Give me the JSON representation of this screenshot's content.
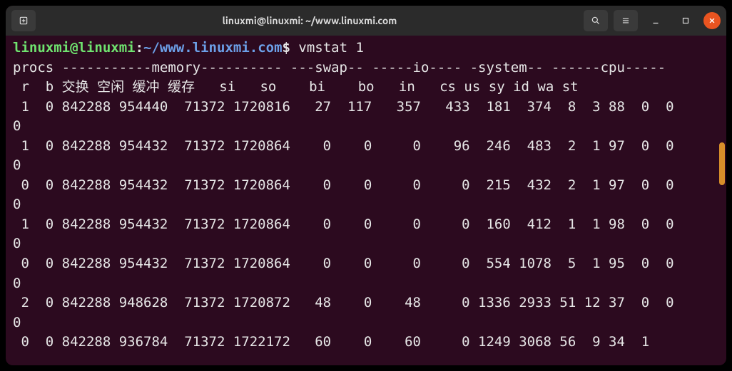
{
  "titlebar": {
    "title": "linuxmi@linuxmi: ~/www.linuxmi.com"
  },
  "prompt": {
    "user_host": "linuxmi@linuxmi",
    "colon": ":",
    "path": "~/www.linuxmi.com",
    "dollar": "$",
    "command": "vmstat 1"
  },
  "vmstat": {
    "header1": "procs -----------memory---------- ---swap-- -----io---- -system-- ------cpu-----",
    "header2": " r  b 交换 空闲 缓冲 缓存   si   so    bi    bo   in   cs us sy id wa st",
    "rows": [
      {
        "r": 1,
        "b": 0,
        "swpd": 842288,
        "free": 954440,
        "buff": 71372,
        "cache": 1720816,
        "si": 27,
        "so": 117,
        "bi": 357,
        "bo": 433,
        "in": 181,
        "cs": 374,
        "us": 8,
        "sy": 3,
        "id": 88,
        "wa": 0,
        "st": 0
      },
      {
        "r": 1,
        "b": 0,
        "swpd": 842288,
        "free": 954432,
        "buff": 71372,
        "cache": 1720864,
        "si": 0,
        "so": 0,
        "bi": 0,
        "bo": 96,
        "in": 246,
        "cs": 483,
        "us": 2,
        "sy": 1,
        "id": 97,
        "wa": 0,
        "st": 0
      },
      {
        "r": 0,
        "b": 0,
        "swpd": 842288,
        "free": 954432,
        "buff": 71372,
        "cache": 1720864,
        "si": 0,
        "so": 0,
        "bi": 0,
        "bo": 0,
        "in": 215,
        "cs": 432,
        "us": 2,
        "sy": 1,
        "id": 97,
        "wa": 0,
        "st": 0
      },
      {
        "r": 1,
        "b": 0,
        "swpd": 842288,
        "free": 954432,
        "buff": 71372,
        "cache": 1720864,
        "si": 0,
        "so": 0,
        "bi": 0,
        "bo": 0,
        "in": 160,
        "cs": 412,
        "us": 1,
        "sy": 1,
        "id": 98,
        "wa": 0,
        "st": 0
      },
      {
        "r": 0,
        "b": 0,
        "swpd": 842288,
        "free": 954432,
        "buff": 71372,
        "cache": 1720864,
        "si": 0,
        "so": 0,
        "bi": 0,
        "bo": 0,
        "in": 554,
        "cs": 1078,
        "us": 5,
        "sy": 1,
        "id": 95,
        "wa": 0,
        "st": 0
      },
      {
        "r": 2,
        "b": 0,
        "swpd": 842288,
        "free": 948628,
        "buff": 71372,
        "cache": 1720872,
        "si": 48,
        "so": 0,
        "bi": 48,
        "bo": 0,
        "in": 1336,
        "cs": 2933,
        "us": 51,
        "sy": 12,
        "id": 37,
        "wa": 0,
        "st": 0
      },
      {
        "r": 0,
        "b": 0,
        "swpd": 842288,
        "free": 936784,
        "buff": 71372,
        "cache": 1722172,
        "si": 60,
        "so": 0,
        "bi": 60,
        "bo": 0,
        "in": 1249,
        "cs": 3068,
        "us": 56,
        "sy": 9,
        "id": 34,
        "wa": 1,
        "st": null
      }
    ]
  }
}
